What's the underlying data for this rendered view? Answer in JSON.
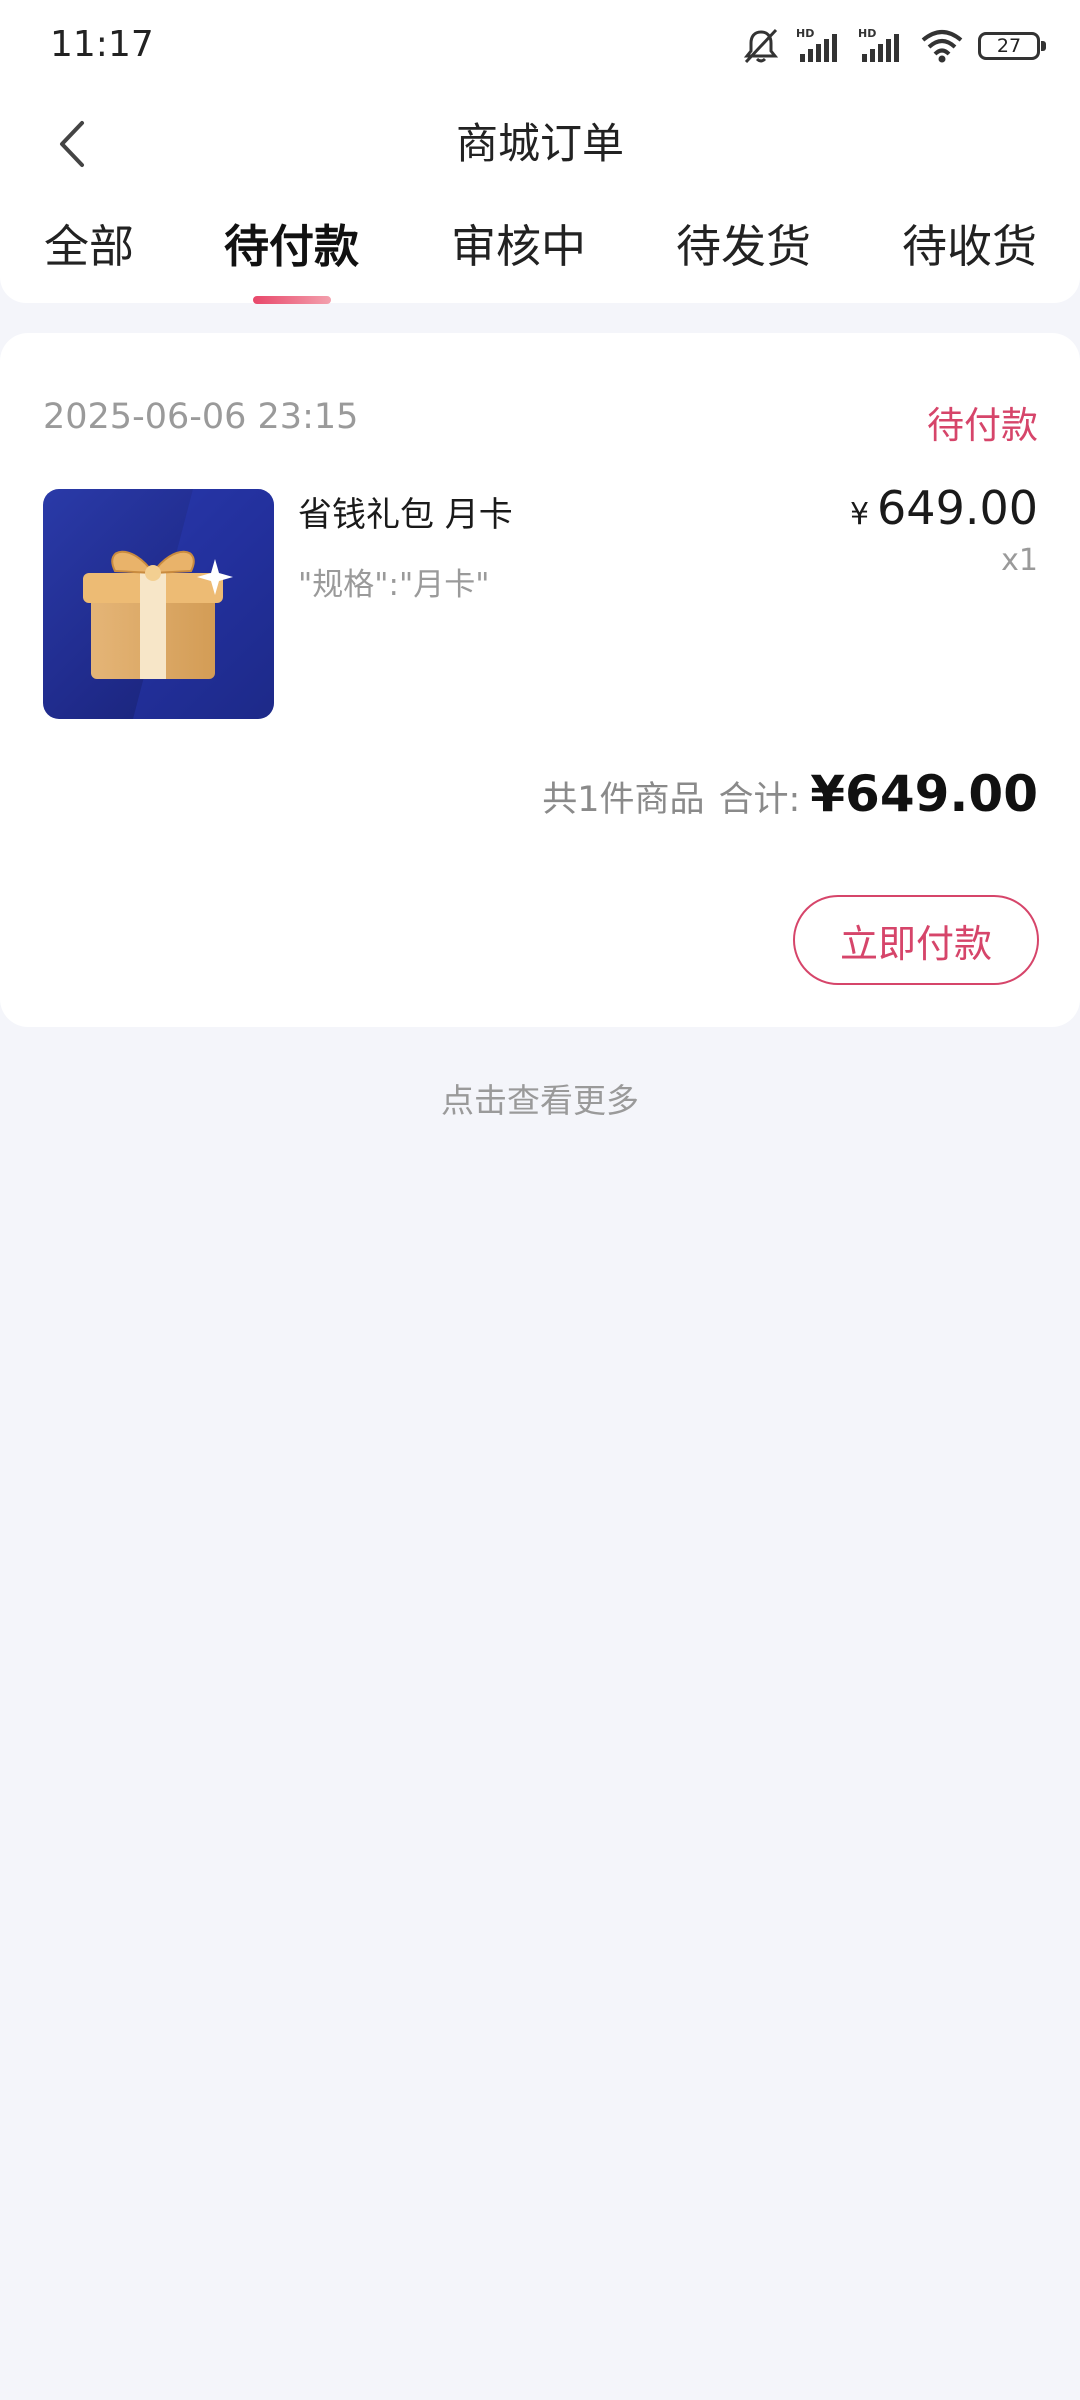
{
  "status_bar": {
    "time": "11:17",
    "battery": "27"
  },
  "header": {
    "title": "商城订单"
  },
  "tabs": [
    {
      "label": "全部"
    },
    {
      "label": "待付款"
    },
    {
      "label": "审核中"
    },
    {
      "label": "待发货"
    },
    {
      "label": "待收货"
    }
  ],
  "active_tab": "待付款",
  "order": {
    "time": "2025-06-06 23:15",
    "status": "待付款",
    "product": {
      "name": "省钱礼包 月卡",
      "spec": "\"规格\":\"月卡\"",
      "currency": "¥",
      "price": "649.00",
      "quantity": "x1"
    },
    "summary": {
      "count": "共1件商品",
      "total_label": "合计:",
      "total": "¥649.00"
    },
    "pay_button": "立即付款"
  },
  "footer": {
    "more": "点击查看更多"
  },
  "colors": {
    "accent": "#d6456a",
    "background": "#f4f5fa"
  }
}
